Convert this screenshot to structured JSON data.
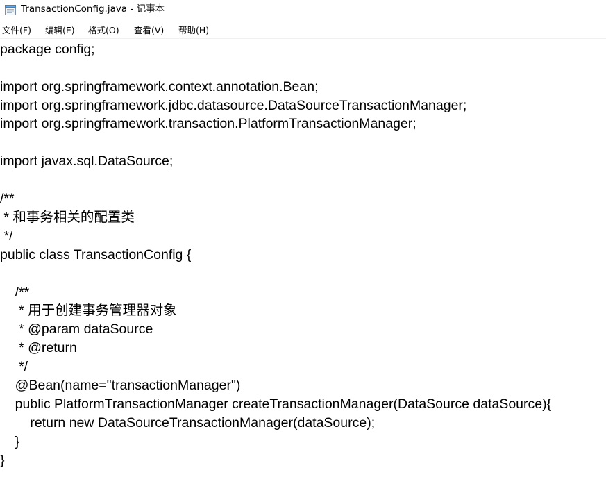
{
  "window": {
    "title": "TransactionConfig.java - 记事本",
    "icon": "notepad-icon"
  },
  "menu": {
    "items": [
      "文件(F)",
      "编辑(E)",
      "格式(O)",
      "查看(V)",
      "帮助(H)"
    ]
  },
  "editor": {
    "lines": [
      "package config;",
      "",
      "import org.springframework.context.annotation.Bean;",
      "import org.springframework.jdbc.datasource.DataSourceTransactionManager;",
      "import org.springframework.transaction.PlatformTransactionManager;",
      "",
      "import javax.sql.DataSource;",
      "",
      "/**",
      " * 和事务相关的配置类",
      " */",
      "public class TransactionConfig {",
      "",
      "    /**",
      "     * 用于创建事务管理器对象",
      "     * @param dataSource",
      "     * @return",
      "     */",
      "    @Bean(name=\"transactionManager\")",
      "    public PlatformTransactionManager createTransactionManager(DataSource dataSource){",
      "        return new DataSourceTransactionManager(dataSource);",
      "    }",
      "}"
    ]
  }
}
